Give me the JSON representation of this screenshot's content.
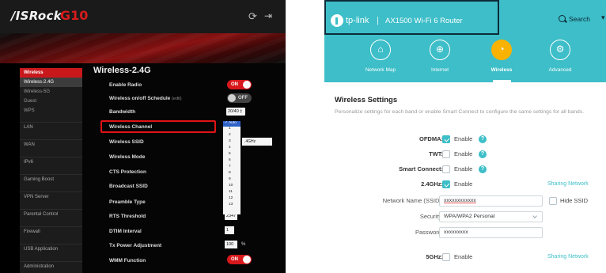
{
  "asrock": {
    "brand": "/ISRock",
    "model": "G10",
    "header_icons": [
      "refresh-icon",
      "logout-icon"
    ],
    "colors": {
      "accent": "#d7181c",
      "background": "#000000"
    },
    "sidebar": {
      "items": [
        {
          "label": "Wireless",
          "type": "section",
          "active": true
        },
        {
          "label": "Wireless-2.4G",
          "type": "sub",
          "selected": true
        },
        {
          "label": "Wireless-5G",
          "type": "sub"
        },
        {
          "label": "Guest",
          "type": "sub"
        },
        {
          "label": "WPS",
          "type": "sub"
        },
        {
          "label": "LAN",
          "type": "section"
        },
        {
          "label": "WAN",
          "type": "section"
        },
        {
          "label": "IPv6",
          "type": "section"
        },
        {
          "label": "Gaming Boost",
          "type": "section"
        },
        {
          "label": "VPN Server",
          "type": "section"
        },
        {
          "label": "Parental Control",
          "type": "section"
        },
        {
          "label": "Firewall",
          "type": "section"
        },
        {
          "label": "USB Application",
          "type": "section"
        },
        {
          "label": "Administration",
          "type": "section"
        }
      ]
    },
    "page_title": "Wireless-2.4G",
    "rows": {
      "enable_radio": {
        "label": "Enable Radio",
        "toggle": "ON"
      },
      "schedule": {
        "label": "Wireless on/off Schedule",
        "edit": "(edit)",
        "toggle": "OFF"
      },
      "bandwidth": {
        "label": "Bandwidth",
        "value": "20/40 ‡"
      },
      "channel": {
        "label": "Wireless Channel",
        "value": "✓ Auto"
      },
      "ssid": {
        "label": "Wireless SSID",
        "value": ".4GHz"
      },
      "mode": {
        "label": "Wireless Mode"
      },
      "cts": {
        "label": "CTS Protection"
      },
      "broadcast": {
        "label": "Broadcast SSID"
      },
      "preamble": {
        "label": "Preamble Type"
      },
      "rts": {
        "label": "RTS Threshold",
        "value": "2347"
      },
      "dtim": {
        "label": "DTIM Interval",
        "value": "1"
      },
      "txpower": {
        "label": "Tx Power Adjustment",
        "value": "100",
        "unit": "%"
      },
      "wmm": {
        "label": "WMM Function",
        "toggle": "ON"
      }
    },
    "channel_options": [
      "Auto",
      "1",
      "2",
      "3",
      "4",
      "5",
      "6",
      "7",
      "8",
      "9",
      "10",
      "11",
      "12",
      "13"
    ]
  },
  "tplink": {
    "brand": "tp-link",
    "separator": "|",
    "model": "AX1500 Wi-Fi 6 Router",
    "search_label": "Search",
    "more_glyph": "▾",
    "colors": {
      "header": "#3dbec8",
      "active_nav": "#f9b200"
    },
    "nav": [
      {
        "label": "Network Map",
        "icon": "network-map-icon",
        "glyph": "⌂"
      },
      {
        "label": "Internet",
        "icon": "globe-icon",
        "glyph": "⊕"
      },
      {
        "label": "Wireless",
        "icon": "wifi-icon",
        "glyph": "◔",
        "active": true
      },
      {
        "label": "Advanced",
        "icon": "gear-icon",
        "glyph": "⚙"
      }
    ],
    "section_title": "Wireless Settings",
    "section_desc": "Personalize settings for each band or enable Smart Connect to configure the same settings for all bands.",
    "ofdma": {
      "label": "OFDMA:",
      "option": "Enable",
      "checked": true
    },
    "twt": {
      "label": "TWT:",
      "option": "Enable",
      "checked": false
    },
    "smart_connect": {
      "label": "Smart Connect:",
      "option": "Enable",
      "checked": false
    },
    "band24": {
      "label": "2.4GHz:",
      "option": "Enable",
      "checked": true,
      "sharing": "Sharing Network"
    },
    "ssid": {
      "label": "Network Name (SSID):",
      "value": "xxxxxxxxxxxx",
      "hide_label": "Hide SSID",
      "hide_checked": false
    },
    "security": {
      "label": "Security:",
      "value": "WPA/WPA2 Personal"
    },
    "password": {
      "label": "Password:",
      "value": "xxxxxxxxx"
    },
    "band5": {
      "label": "5GHz:",
      "option": "Enable",
      "checked": false,
      "sharing": "Sharing Network"
    }
  }
}
